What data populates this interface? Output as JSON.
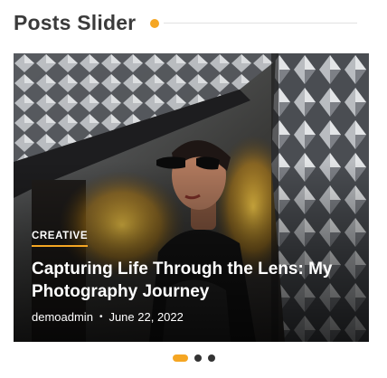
{
  "widget": {
    "title": "Posts Slider",
    "accent_color": "#f5a623"
  },
  "slide": {
    "category": "CREATIVE",
    "title": "Capturing Life Through the Lens: My Photography Journey",
    "author": "demoadmin",
    "separator": "•",
    "date": "June 22, 2022"
  },
  "pagination": {
    "total": 3,
    "active_index": 0
  }
}
